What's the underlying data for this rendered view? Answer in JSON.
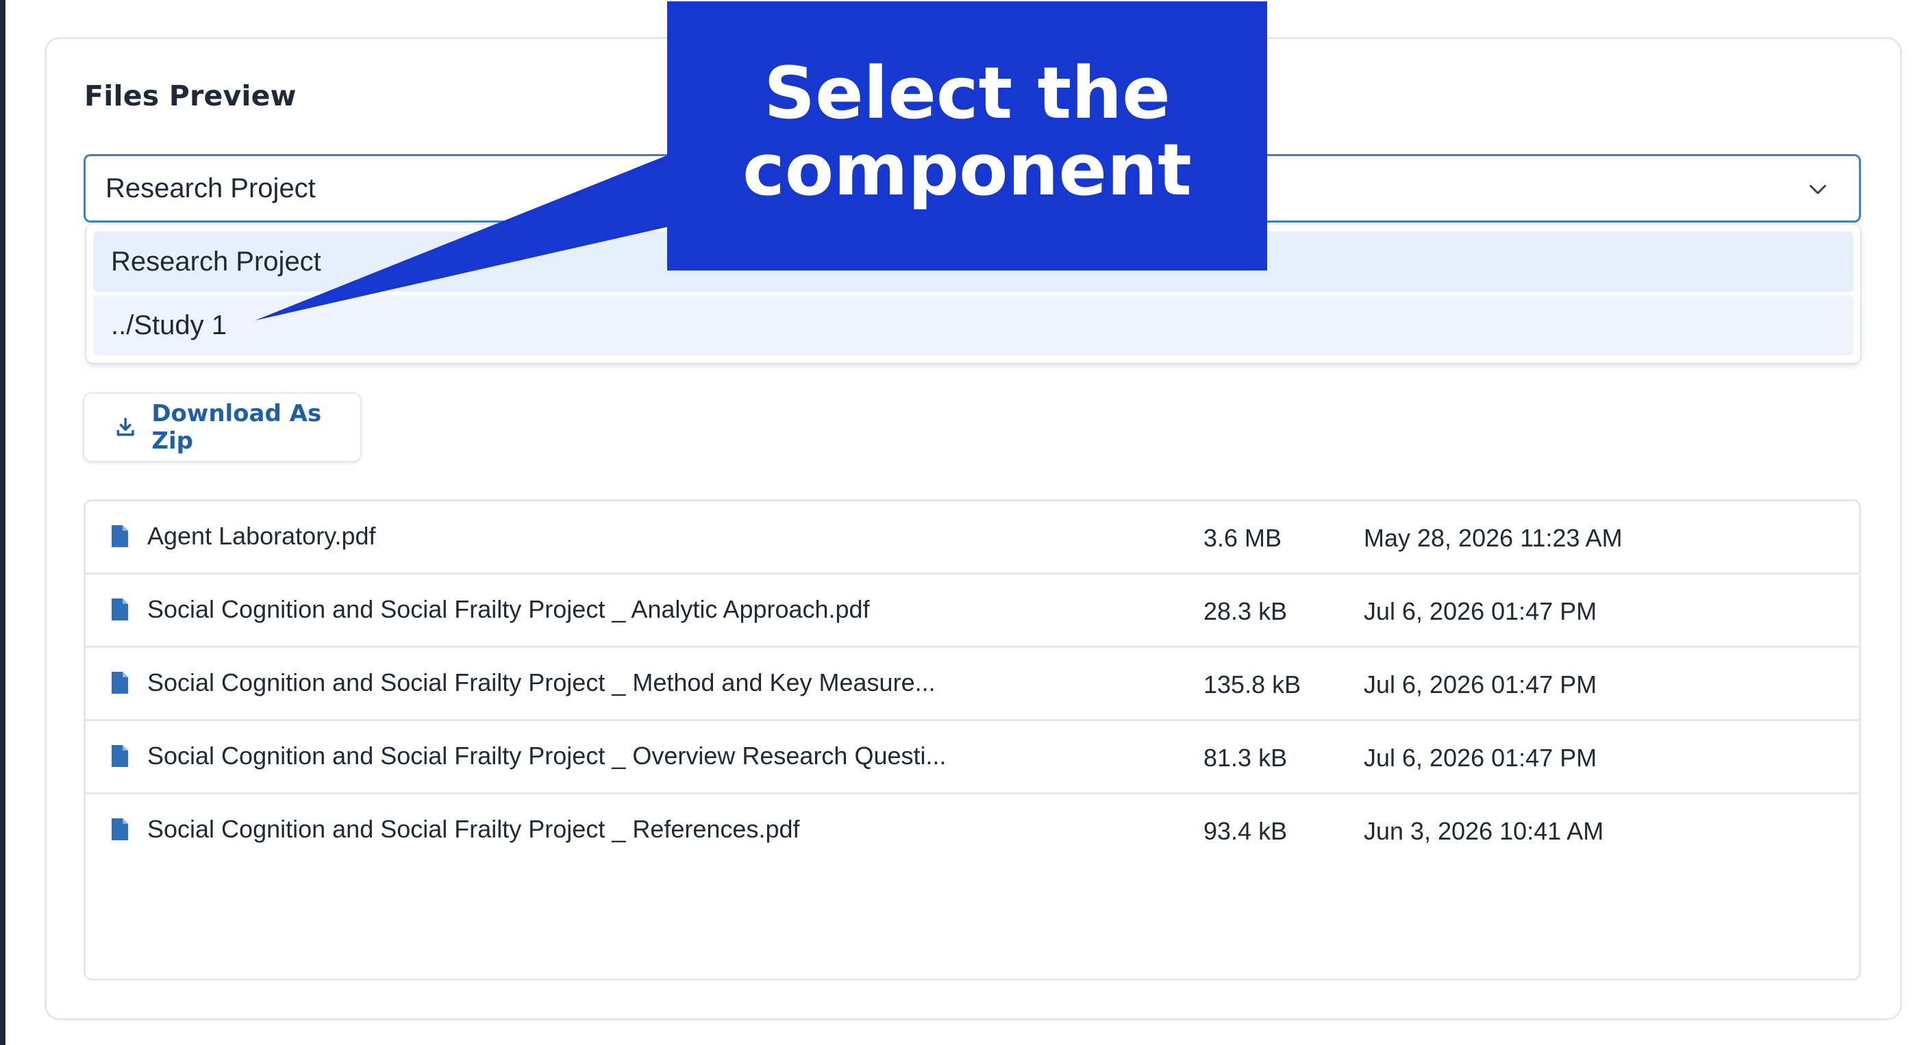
{
  "card": {
    "title": "Files Preview"
  },
  "select": {
    "value": "Research Project",
    "options": [
      {
        "label": "Research Project",
        "state": "selected"
      },
      {
        "label": "../Study 1",
        "state": "hovered"
      }
    ]
  },
  "toolbar": {
    "download_zip_label": "Download As Zip"
  },
  "files": [
    {
      "name": "Agent Laboratory.pdf",
      "size": "3.6 MB",
      "modified": "May 28, 2026 11:23 AM"
    },
    {
      "name": "Social Cognition and Social Frailty Project _ Analytic Approach.pdf",
      "size": "28.3 kB",
      "modified": "Jul 6, 2026 01:47 PM"
    },
    {
      "name": "Social Cognition and Social Frailty Project _ Method and Key Measure...",
      "size": "135.8 kB",
      "modified": "Jul 6, 2026 01:47 PM"
    },
    {
      "name": "Social Cognition and Social Frailty Project _ Overview Research Questi...",
      "size": "81.3 kB",
      "modified": "Jul 6, 2026 01:47 PM"
    },
    {
      "name": "Social Cognition and Social Frailty Project _ References.pdf",
      "size": "93.4 kB",
      "modified": "Jun 3, 2026 10:41 AM"
    }
  ],
  "annotation": {
    "line1": "Select the",
    "line2": "component"
  },
  "icons": {
    "select": "chevron-down-icon",
    "download": "download-icon",
    "file": "file-icon"
  },
  "colors": {
    "accent": "#1f5fa8",
    "select_border": "#3b82c4",
    "callout": "#1638d1",
    "option_highlight": "#e6f0fc"
  }
}
